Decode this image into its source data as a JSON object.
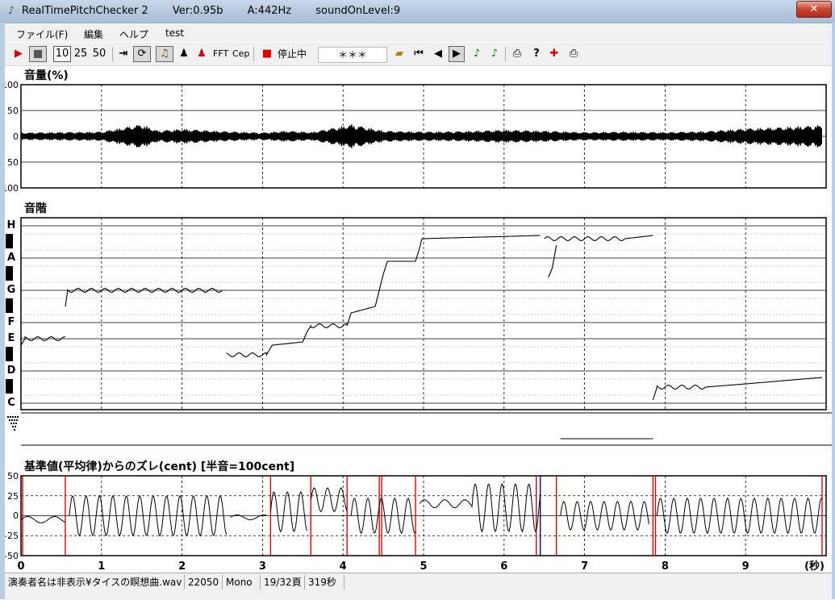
{
  "window": {
    "title_segments": [
      "RealTimePitchChecker 2",
      "Ver:0.95b",
      "A:442Hz",
      "soundOnLevel:9"
    ],
    "close_label": "✕"
  },
  "menu": [
    "ファイル(F)",
    "編集",
    "ヘルプ",
    "test"
  ],
  "toolbar": {
    "speed_options": [
      "10",
      "25",
      "50"
    ],
    "fft_label": "FFT",
    "cep_label": "Cep",
    "state_label": "停止中",
    "status_field": "＊＊＊"
  },
  "volume_panel": {
    "title": "音量(%)",
    "y_labels": [
      "100",
      "50",
      "0",
      "50",
      "100"
    ]
  },
  "scale_panel": {
    "title": "音階",
    "note_labels": [
      "H",
      "A",
      "G",
      "F",
      "E",
      "D",
      "C"
    ]
  },
  "deviation_panel": {
    "title": "基準値(平均律)からのズレ(cent) [半音=100cent]",
    "y_labels": [
      "50",
      "25",
      "0",
      "-25",
      "-50"
    ],
    "x_labels": [
      "0",
      "1",
      "2",
      "3",
      "4",
      "5",
      "6",
      "7",
      "8",
      "9"
    ],
    "x_unit": "(秒)"
  },
  "statusbar": {
    "file": "演奏者名は非表示¥タイスの瞑想曲.wav",
    "rate": "22050",
    "channels": "Mono",
    "page": "19/32頁",
    "duration": "319秒"
  },
  "chart_data": [
    {
      "type": "area",
      "title": "音量(%)",
      "xlim": [
        0,
        10
      ],
      "ylim": [
        -100,
        100
      ],
      "y_ticks_printed": [
        "100",
        "50",
        "0",
        "50",
        "100"
      ],
      "grid": true,
      "envelope": [
        [
          0.0,
          8
        ],
        [
          0.5,
          9
        ],
        [
          1.0,
          10
        ],
        [
          1.5,
          26
        ],
        [
          1.7,
          12
        ],
        [
          2.0,
          16
        ],
        [
          2.5,
          11
        ],
        [
          3.0,
          8
        ],
        [
          3.3,
          12
        ],
        [
          3.6,
          9
        ],
        [
          4.0,
          22
        ],
        [
          4.1,
          26
        ],
        [
          4.5,
          12
        ],
        [
          5.0,
          10
        ],
        [
          5.5,
          11
        ],
        [
          6.0,
          14
        ],
        [
          6.5,
          12
        ],
        [
          7.0,
          9
        ],
        [
          7.5,
          10
        ],
        [
          8.0,
          9
        ],
        [
          8.5,
          11
        ],
        [
          9.0,
          17
        ],
        [
          9.5,
          20
        ],
        [
          9.95,
          24
        ]
      ]
    },
    {
      "type": "line",
      "title": "音階",
      "xlim": [
        0,
        10
      ],
      "y_notes": [
        "C",
        "D",
        "E",
        "F",
        "G",
        "A",
        "H"
      ],
      "grid": true,
      "segments": [
        [
          [
            0.0,
            -0.2
          ],
          [
            0.05,
            0.0
          ],
          [
            0.55,
            0.0
          ]
        ],
        [
          [
            0.55,
            1.0
          ],
          [
            0.58,
            1.5
          ],
          [
            2.5,
            1.5
          ]
        ],
        [
          [
            2.55,
            -0.5
          ],
          [
            3.05,
            -0.5
          ],
          [
            3.12,
            -0.2
          ],
          [
            3.5,
            -0.1
          ],
          [
            3.55,
            0.2
          ],
          [
            3.6,
            0.4
          ],
          [
            4.05,
            0.4
          ],
          [
            4.1,
            0.8
          ],
          [
            4.4,
            1.0
          ],
          [
            4.45,
            1.5
          ],
          [
            4.5,
            2.0
          ],
          [
            4.55,
            2.4
          ],
          [
            4.9,
            2.4
          ],
          [
            4.95,
            2.8
          ],
          [
            4.98,
            3.1
          ],
          [
            6.45,
            3.2
          ]
        ],
        [
          [
            6.5,
            3.1
          ],
          [
            7.5,
            3.1
          ],
          [
            7.85,
            3.2
          ]
        ],
        [
          [
            6.55,
            1.9
          ],
          [
            6.6,
            2.2
          ],
          [
            6.65,
            2.9
          ]
        ],
        [
          [
            7.85,
            -1.9
          ],
          [
            7.9,
            -1.5
          ],
          [
            8.5,
            -1.5
          ],
          [
            9.0,
            -1.4
          ],
          [
            9.95,
            -1.2
          ]
        ]
      ]
    },
    {
      "type": "line",
      "title": "基準値(平均律)からのズレ(cent) [半音=100cent]",
      "xlabel": "(秒)",
      "ylabel": "cent",
      "xlim": [
        0,
        10
      ],
      "ylim": [
        -50,
        50
      ],
      "x_ticks": [
        0,
        1,
        2,
        3,
        4,
        5,
        6,
        7,
        8,
        9
      ],
      "y_ticks": [
        50,
        25,
        0,
        -25,
        -50
      ],
      "grid": true,
      "segments": [
        {
          "type": "flat",
          "x0": 0.0,
          "x1": 0.55,
          "y": -5,
          "amp": 4,
          "freq": 3
        },
        {
          "type": "vibrato",
          "x0": 0.6,
          "x1": 2.55,
          "center": 0,
          "amp": 25,
          "freq": 6
        },
        {
          "type": "flat",
          "x0": 2.6,
          "x1": 3.05,
          "y": -2,
          "amp": 3,
          "freq": 3
        },
        {
          "type": "vibrato",
          "x0": 3.1,
          "x1": 3.55,
          "center": 5,
          "amp": 25,
          "freq": 6
        },
        {
          "type": "vibrato",
          "x0": 3.6,
          "x1": 4.05,
          "center": 20,
          "amp": 15,
          "freq": 6
        },
        {
          "type": "vibrato",
          "x0": 4.1,
          "x1": 4.9,
          "center": 0,
          "amp": 22,
          "freq": 6
        },
        {
          "type": "flat",
          "x0": 4.95,
          "x1": 5.6,
          "y": 15,
          "amp": 5,
          "freq": 4
        },
        {
          "type": "vibrato",
          "x0": 5.6,
          "x1": 6.45,
          "center": 10,
          "amp": 30,
          "freq": 6
        },
        {
          "type": "vibrato",
          "x0": 6.7,
          "x1": 7.8,
          "center": 0,
          "amp": 18,
          "freq": 6
        },
        {
          "type": "vibrato",
          "x0": 7.9,
          "x1": 9.95,
          "center": 0,
          "amp": 22,
          "freq": 6
        }
      ],
      "red_markers": [
        0.02,
        0.55,
        3.1,
        3.6,
        4.05,
        4.45,
        4.48,
        4.9,
        6.4,
        6.65,
        7.85,
        7.88,
        9.95
      ],
      "blue_markers": [
        6.45
      ]
    }
  ]
}
